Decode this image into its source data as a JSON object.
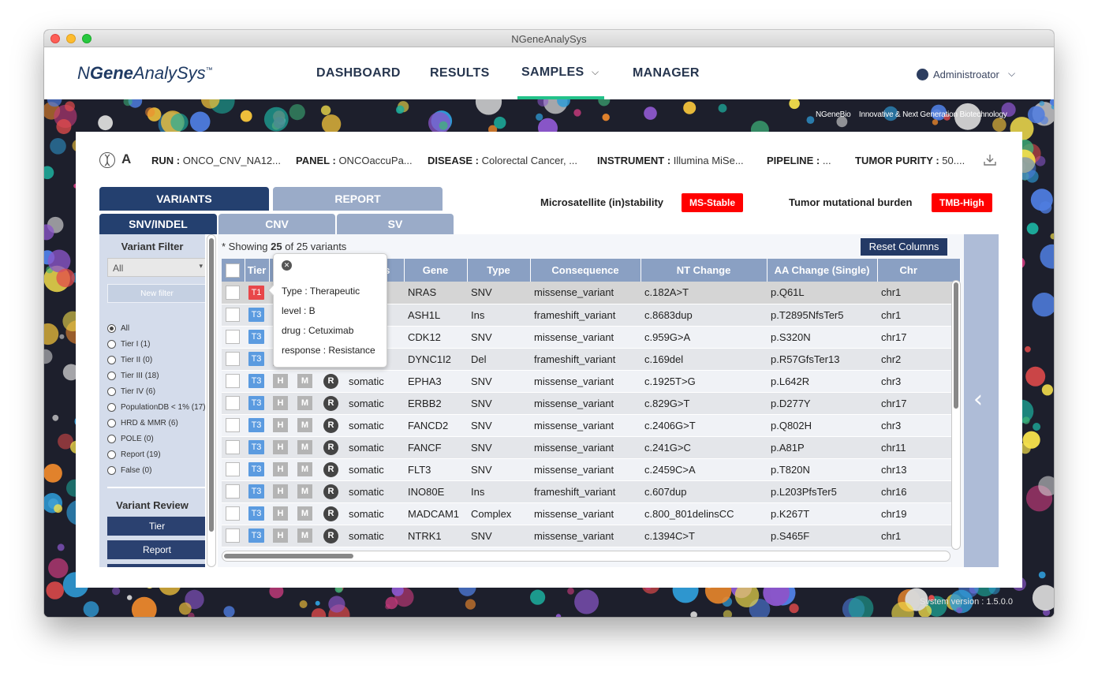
{
  "window": {
    "title": "NGeneAnalySys"
  },
  "header": {
    "logo_prefix": "N",
    "logo_bold": "Gene",
    "logo_suffix": "AnalySys",
    "logo_tm": "™",
    "nav": [
      "DASHBOARD",
      "RESULTS",
      "SAMPLES",
      "MANAGER"
    ],
    "samples_chevron": "⌵",
    "user": "Administroator",
    "user_chevron": "⌵"
  },
  "banner": {
    "brand": "NGeneBio",
    "tagline": "Innovative & Next Generation Biotechnology",
    "system_version": "System version : 1.5.0.0"
  },
  "sample": {
    "name": "A",
    "run_label": "RUN :",
    "run_value": "ONCO_CNV_NA12...",
    "panel_label": "PANEL :",
    "panel_value": "ONCOaccuPa...",
    "disease_label": "DISEASE :",
    "disease_value": "Colorectal Cancer, ...",
    "instrument_label": "INSTRUMENT :",
    "instrument_value": "Illumina MiSe...",
    "pipeline_label": "PIPELINE :",
    "pipeline_value": "...",
    "purity_label": "TUMOR PURITY :",
    "purity_value": "50...."
  },
  "tabs": {
    "main": [
      "VARIANTS",
      "REPORT"
    ],
    "sub": [
      "SNV/INDEL",
      "CNV",
      "SV"
    ]
  },
  "biomarkers": {
    "msi_label": "Microsatellite (in)stability",
    "msi_value": "MS-Stable",
    "tmb_label": "Tumor mutational burden",
    "tmb_value": "TMB-High"
  },
  "filter": {
    "title": "Variant Filter",
    "select_value": "All",
    "new_filter": "New filter",
    "options": [
      "All",
      "Tier I (1)",
      "Tier II (0)",
      "Tier III (18)",
      "Tier IV (6)",
      "PopulationDB < 1% (17)",
      "HRD & MMR (6)",
      "POLE (0)",
      "Report (19)",
      "False (0)"
    ],
    "selected_index": 0,
    "review_title": "Variant Review",
    "review_buttons": [
      "Tier",
      "Report"
    ]
  },
  "table": {
    "showing_prefix": "* Showing",
    "showing_count": "25",
    "showing_suffix": "of 25 variants",
    "reset_label": "Reset Columns",
    "columns": [
      "",
      "Tier",
      "H",
      "",
      "",
      "Status",
      "Gene",
      "Type",
      "Consequence",
      "NT Change",
      "AA Change (Single)",
      "Chr"
    ],
    "rows": [
      {
        "tier": "T1",
        "h": "H",
        "m": "M",
        "r": "R",
        "status": "somatic",
        "gene": "NRAS",
        "type": "SNV",
        "consequence": "missense_variant",
        "nt": "c.182A>T",
        "aa": "p.Q61L",
        "chr": "chr1"
      },
      {
        "tier": "T3",
        "h": "H",
        "m": "M",
        "r": "R",
        "status": "somatic",
        "gene": "ASH1L",
        "type": "Ins",
        "consequence": "frameshift_variant",
        "nt": "c.8683dup",
        "aa": "p.T2895NfsTer5",
        "chr": "chr1"
      },
      {
        "tier": "T3",
        "h": "H",
        "m": "M",
        "r": "R",
        "status": "somatic",
        "gene": "CDK12",
        "type": "SNV",
        "consequence": "missense_variant",
        "nt": "c.959G>A",
        "aa": "p.S320N",
        "chr": "chr17"
      },
      {
        "tier": "T3",
        "h": "H",
        "m": "M",
        "r": "R",
        "status": "somatic",
        "gene": "DYNC1I2",
        "type": "Del",
        "consequence": "frameshift_variant",
        "nt": "c.169del",
        "aa": "p.R57GfsTer13",
        "chr": "chr2"
      },
      {
        "tier": "T3",
        "h": "H",
        "m": "M",
        "r": "R",
        "status": "somatic",
        "gene": "EPHA3",
        "type": "SNV",
        "consequence": "missense_variant",
        "nt": "c.1925T>G",
        "aa": "p.L642R",
        "chr": "chr3"
      },
      {
        "tier": "T3",
        "h": "H",
        "m": "M",
        "r": "R",
        "status": "somatic",
        "gene": "ERBB2",
        "type": "SNV",
        "consequence": "missense_variant",
        "nt": "c.829G>T",
        "aa": "p.D277Y",
        "chr": "chr17"
      },
      {
        "tier": "T3",
        "h": "H",
        "m": "M",
        "r": "R",
        "status": "somatic",
        "gene": "FANCD2",
        "type": "SNV",
        "consequence": "missense_variant",
        "nt": "c.2406G>T",
        "aa": "p.Q802H",
        "chr": "chr3"
      },
      {
        "tier": "T3",
        "h": "H",
        "m": "M",
        "r": "R",
        "status": "somatic",
        "gene": "FANCF",
        "type": "SNV",
        "consequence": "missense_variant",
        "nt": "c.241G>C",
        "aa": "p.A81P",
        "chr": "chr11"
      },
      {
        "tier": "T3",
        "h": "H",
        "m": "M",
        "r": "R",
        "status": "somatic",
        "gene": "FLT3",
        "type": "SNV",
        "consequence": "missense_variant",
        "nt": "c.2459C>A",
        "aa": "p.T820N",
        "chr": "chr13"
      },
      {
        "tier": "T3",
        "h": "H",
        "m": "M",
        "r": "R",
        "status": "somatic",
        "gene": "INO80E",
        "type": "Ins",
        "consequence": "frameshift_variant",
        "nt": "c.607dup",
        "aa": "p.L203PfsTer5",
        "chr": "chr16"
      },
      {
        "tier": "T3",
        "h": "H",
        "m": "M",
        "r": "R",
        "status": "somatic",
        "gene": "MADCAM1",
        "type": "Complex",
        "consequence": "missense_variant",
        "nt": "c.800_801delinsCC",
        "aa": "p.K267T",
        "chr": "chr19"
      },
      {
        "tier": "T3",
        "h": "H",
        "m": "M",
        "r": "R",
        "status": "somatic",
        "gene": "NTRK1",
        "type": "SNV",
        "consequence": "missense_variant",
        "nt": "c.1394C>T",
        "aa": "p.S465F",
        "chr": "chr1"
      }
    ]
  },
  "tooltip": {
    "close": "✕",
    "lines": [
      "Type : Therapeutic",
      "level : B",
      "drug : Cetuximab",
      "response : Resistance"
    ]
  },
  "colors": {
    "nav_active": "#23c28a",
    "tab_active": "#24406f",
    "tab_inactive": "#9aabc8",
    "badge_red": "#ff0000",
    "tier1": "#e8474a",
    "tier3": "#5b9be0"
  },
  "icons": {
    "sample": "dna-icon",
    "download": "download-icon",
    "user": "user-icon",
    "collapse": "chevron-left-icon"
  }
}
